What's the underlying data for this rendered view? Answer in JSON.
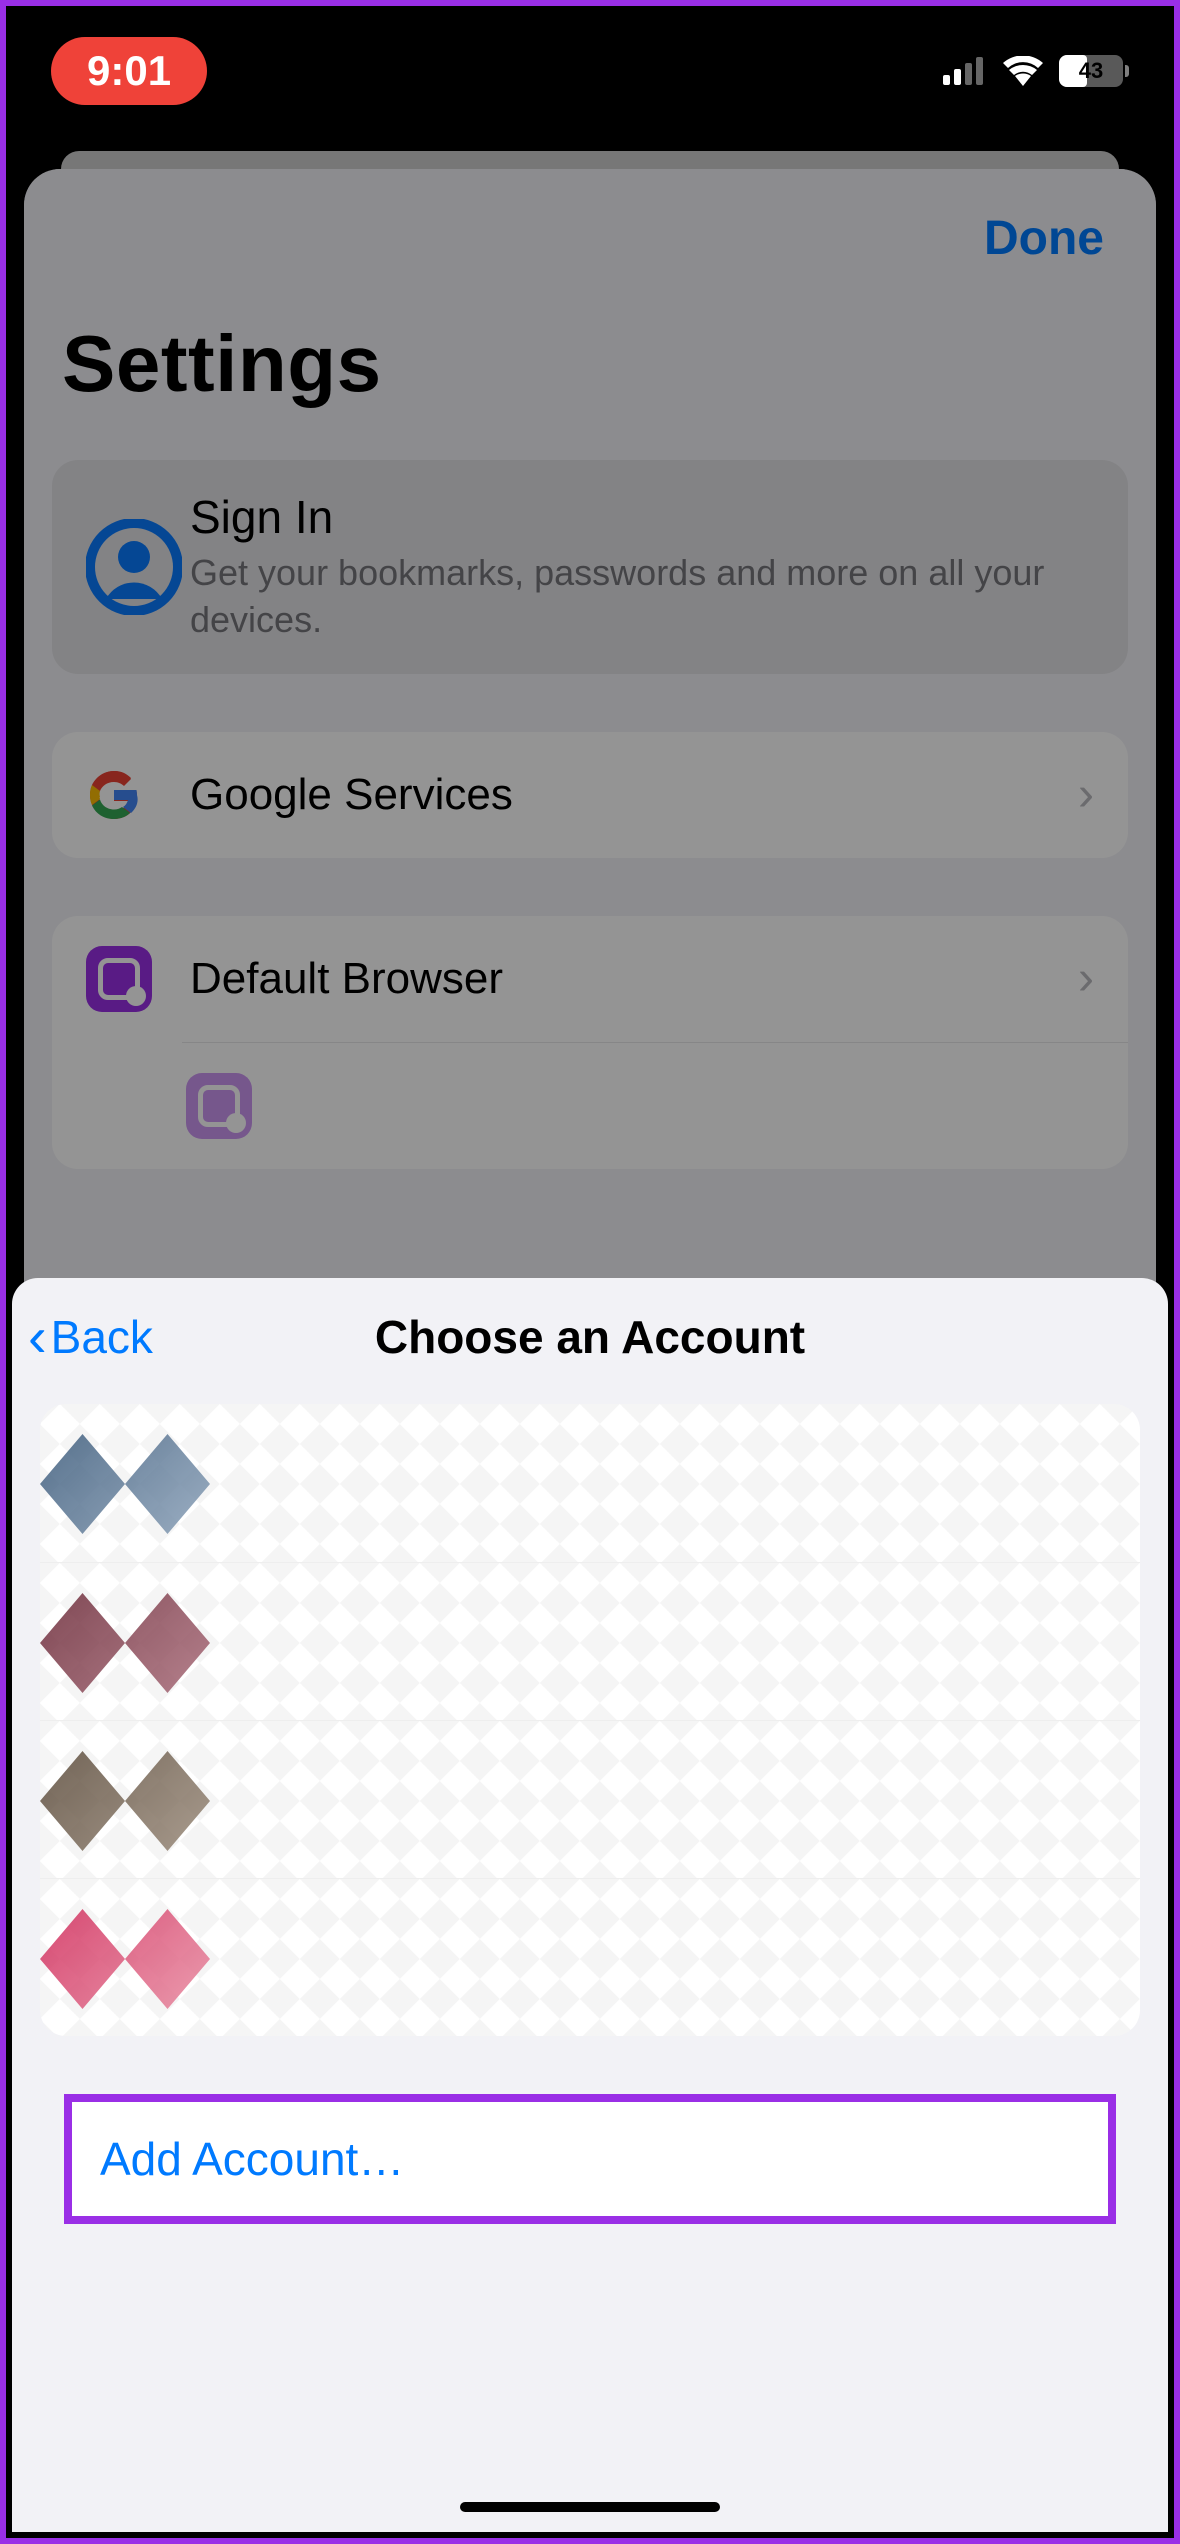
{
  "status": {
    "time": "9:01",
    "battery_pct": "43"
  },
  "background": {
    "done": "Done",
    "title": "Settings",
    "signin": {
      "title": "Sign In",
      "subtitle": "Get your bookmarks, passwords and more on all your devices."
    },
    "rows": {
      "google_services": "Google Services",
      "default_browser": "Default Browser"
    }
  },
  "sheet": {
    "back": "Back",
    "title": "Choose an Account",
    "add_account": "Add Account…"
  }
}
